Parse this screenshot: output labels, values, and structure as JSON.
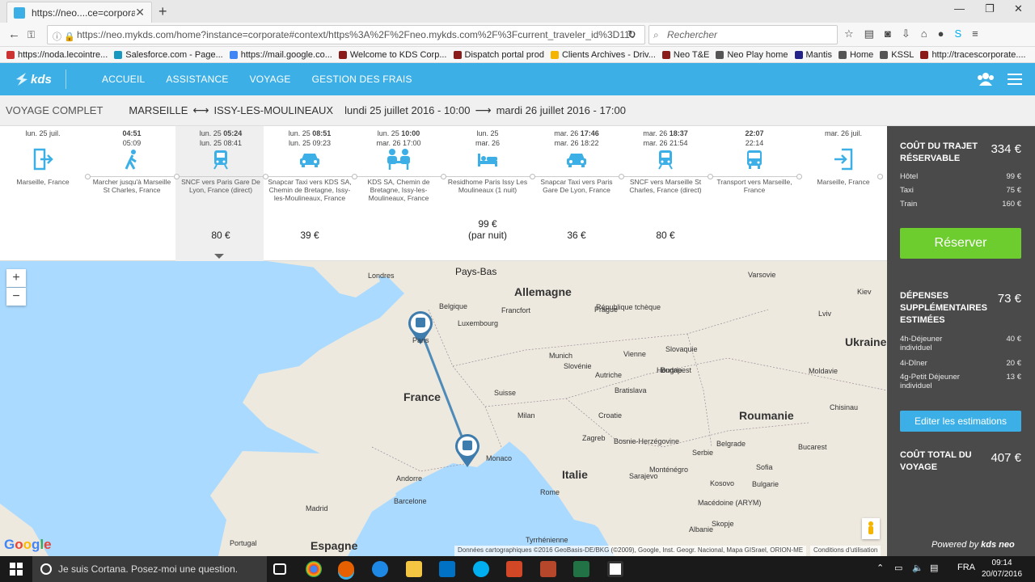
{
  "browser": {
    "tab_title": "https://neo....ce=corporate",
    "url": "https://neo.mykds.com/home?instance=corporate#context/https%3A%2F%2Fneo.mykds.com%2F%3Fcurrent_traveler_id%3D110",
    "search_placeholder": "Rechercher",
    "bookmarks": [
      {
        "label": "https://noda.lecointre...",
        "color": "#cc3333"
      },
      {
        "label": "Salesforce.com - Page...",
        "color": "#1798c1"
      },
      {
        "label": "https://mail.google.co...",
        "color": "#4285f4"
      },
      {
        "label": "Welcome to KDS Corp...",
        "color": "#8b1a1a"
      },
      {
        "label": "Dispatch portal prod",
        "color": "#8b1a1a"
      },
      {
        "label": "Clients Archives - Driv...",
        "color": "#f4b400"
      },
      {
        "label": "Neo T&E",
        "color": "#8b1a1a"
      },
      {
        "label": "Neo Play home",
        "color": "#555555"
      },
      {
        "label": "Mantis",
        "color": "#222288"
      },
      {
        "label": "Home",
        "color": "#555555"
      },
      {
        "label": "KSSL",
        "color": "#555555"
      },
      {
        "label": "http://tracescorporate....",
        "color": "#8b1a1a"
      }
    ]
  },
  "app": {
    "logo": "kds",
    "nav": [
      "ACCUEIL",
      "ASSISTANCE",
      "VOYAGE",
      "GESTION DES FRAIS"
    ],
    "accent": "#3cb0e6"
  },
  "trip": {
    "label": "VOYAGE COMPLET",
    "from": "MARSEILLE",
    "to": "ISSY-LES-MOULINEAUX",
    "depart": "lundi 25 juillet 2016 - 10:00",
    "return": "mardi 26 juillet 2016 - 17:00"
  },
  "timeline": [
    {
      "d1": "lun. 25 juil.",
      "t1": "",
      "d2": "",
      "t2": "",
      "icon": "exit-icon",
      "desc": "Marseille, France",
      "price": ""
    },
    {
      "d1": "",
      "t1": "04:51",
      "d2": "",
      "t2": "05:09",
      "icon": "walk-icon",
      "desc": "Marcher jusqu'à Marseille St Charles, France",
      "price": ""
    },
    {
      "d1": "lun. 25",
      "t1": "05:24",
      "d2": "lun. 25",
      "t2": "08:41",
      "icon": "train-icon",
      "desc": "SNCF vers Paris Gare De Lyon, France (direct)",
      "price": "80 €"
    },
    {
      "d1": "lun. 25",
      "t1": "08:51",
      "d2": "lun. 25",
      "t2": "09:23",
      "icon": "taxi-icon",
      "desc": "Snapcar Taxi vers KDS SA, Chemin de Bretagne, Issy-les-Moulineaux, France",
      "price": "39 €"
    },
    {
      "d1": "lun. 25",
      "t1": "10:00",
      "d2": "mar. 26",
      "t2": "17:00",
      "icon": "meeting-icon",
      "desc": "KDS SA, Chemin de Bretagne, Issy-les-Moulineaux, France",
      "price": ""
    },
    {
      "d1": "lun. 25",
      "t1": "",
      "d2": "mar. 26",
      "t2": "",
      "icon": "hotel-icon",
      "desc": "Residhome Paris Issy Les Moulineaux (1 nuit)",
      "price": "99 €",
      "price_note": "(par nuit)"
    },
    {
      "d1": "mar. 26",
      "t1": "17:46",
      "d2": "mar. 26",
      "t2": "18:22",
      "icon": "taxi-icon",
      "desc": "Snapcar Taxi vers Paris Gare De Lyon, France",
      "price": "36 €"
    },
    {
      "d1": "mar. 26",
      "t1": "18:37",
      "d2": "mar. 26",
      "t2": "21:54",
      "icon": "train-icon",
      "desc": "SNCF vers Marseille St Charles, France (direct)",
      "price": "80 €"
    },
    {
      "d1": "",
      "t1": "22:07",
      "d2": "",
      "t2": "22:14",
      "icon": "bus-icon",
      "desc": "Transport vers Marseille, France",
      "price": ""
    },
    {
      "d1": "mar. 26 juil.",
      "t1": "",
      "d2": "",
      "t2": "",
      "icon": "enter-icon",
      "desc": "Marseille, France",
      "price": ""
    }
  ],
  "map": {
    "countries": [
      "Allemagne",
      "France",
      "Italie",
      "Espagne",
      "Roumanie",
      "Ukraine",
      "Pays-Bas",
      "Belgique",
      "Luxembourg",
      "Suisse",
      "Autriche",
      "République tchèque",
      "Slovaquie",
      "Hongrie",
      "Croatie",
      "Serbie",
      "Bulgarie",
      "Monaco",
      "Andorre",
      "Portugal",
      "Slovénie",
      "Bosnie-Herzégovine",
      "Monténégro",
      "Macédoine (ARYM)",
      "Moldavie",
      "Kosovo",
      "Albanie",
      "Tyrrhénienne"
    ],
    "cities": [
      "Londres",
      "Varsovie",
      "Prague",
      "Francfort",
      "Munich",
      "Vienne",
      "Budapest",
      "Milan",
      "Rome",
      "Barcelone",
      "Madrid",
      "Sarajevo",
      "Belgrade",
      "Sofia",
      "Bucarest",
      "Lviv",
      "Kiev",
      "Chisinau",
      "Skopje",
      "Zagreb",
      "Bratislava"
    ],
    "paris_label": "Paris",
    "zoom_in": "+",
    "zoom_out": "−",
    "google": "Google",
    "attribution": "Données cartographiques ©2016 GeoBasis-DE/BKG (©2009), Google, Inst. Geogr. Nacional, Mapa GISrael, ORION-ME",
    "terms": "Conditions d'utilisation",
    "route_color": "#4e8bb8"
  },
  "summary": {
    "bookable_label": "COÛT DU TRAJET RÉSERVABLE",
    "bookable_amount": "334 €",
    "bookable_items": [
      {
        "label": "Hôtel",
        "value": "99 €"
      },
      {
        "label": "Taxi",
        "value": "75 €"
      },
      {
        "label": "Train",
        "value": "160 €"
      }
    ],
    "reserve_button": "Réserver",
    "extra_label": "DÉPENSES SUPPLÉMENTAIRES ESTIMÉES",
    "extra_amount": "73 €",
    "extra_items": [
      {
        "label": "4h-Déjeuner individuel",
        "value": "40 €"
      },
      {
        "label": "4i-Dîner",
        "value": "20 €"
      },
      {
        "label": "4g-Petit Déjeuner individuel",
        "value": "13 €"
      }
    ],
    "edit_button": "Editer les estimations",
    "total_label": "COÛT TOTAL DU VOYAGE",
    "total_amount": "407 €",
    "powered": "Powered by",
    "powered_brand": "kds neo"
  },
  "taskbar": {
    "cortana": "Je suis Cortana. Posez-moi une question.",
    "lang": "FRA",
    "time": "09:14",
    "date": "20/07/2016"
  }
}
